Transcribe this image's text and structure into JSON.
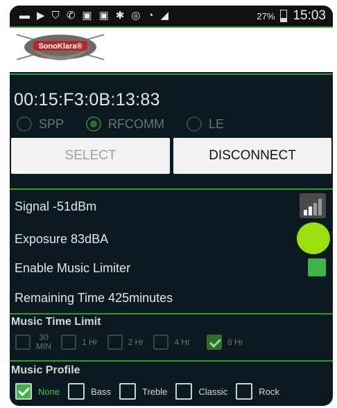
{
  "status_bar": {
    "icons": [
      "keyboard-icon",
      "play-icon",
      "shield-icon",
      "phone-icon",
      "image-icon",
      "image-icon",
      "bluetooth-icon",
      "wifi-hotspot-icon",
      "wifi-icon",
      "cell-signal-icon"
    ],
    "battery": "27%",
    "time": "15:03"
  },
  "header": {
    "logo_text": "SonoKlara®"
  },
  "device": {
    "address": "00:15:F3:0B:13:83",
    "protocols": [
      {
        "label": "SPP",
        "selected": false
      },
      {
        "label": "RFCOMM",
        "selected": true
      },
      {
        "label": "LE",
        "selected": false
      }
    ],
    "select_label": "SELECT",
    "disconnect_label": "DISCONNECT"
  },
  "readings": {
    "signal": "Signal -51dBm",
    "exposure": "Exposure 83dBA",
    "limiter_label": "Enable Music Limiter",
    "limiter_enabled": true,
    "remaining": "Remaining Time 425minutes",
    "exposure_color": "#9cdf0f"
  },
  "time_limit": {
    "title": "Music Time Limit",
    "options": [
      {
        "label_line1": "30",
        "label_line2": "MIN",
        "checked": false
      },
      {
        "label": "1 Hr",
        "checked": false
      },
      {
        "label": "2 Hr",
        "checked": false
      },
      {
        "label": "4 Hr",
        "checked": false
      },
      {
        "label": "8 Hr",
        "checked": true
      }
    ]
  },
  "profile": {
    "title": "Music Profile",
    "options": [
      {
        "label": "None",
        "checked": true
      },
      {
        "label": "Bass",
        "checked": false
      },
      {
        "label": "Treble",
        "checked": false
      },
      {
        "label": "Classic",
        "checked": false
      },
      {
        "label": "Rock",
        "checked": false
      }
    ]
  },
  "colors": {
    "accent": "#2e9e2e",
    "background": "#0a1a20"
  }
}
